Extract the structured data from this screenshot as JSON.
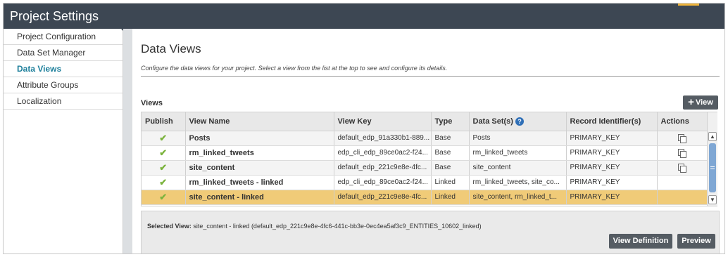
{
  "app": {
    "title": "Project Settings"
  },
  "sidebar": {
    "items": [
      {
        "label": "Project Configuration",
        "active": false
      },
      {
        "label": "Data Set Manager",
        "active": false
      },
      {
        "label": "Data Views",
        "active": true
      },
      {
        "label": "Attribute Groups",
        "active": false
      },
      {
        "label": "Localization",
        "active": false
      }
    ]
  },
  "main": {
    "title": "Data Views",
    "description": "Configure the data views for your project. Select a view from the list at the top to see and configure its details.",
    "views_label": "Views",
    "add_view_label": "View"
  },
  "table": {
    "columns": [
      "Publish",
      "View Name",
      "View Key",
      "Type",
      "Data Set(s)",
      "Record Identifier(s)",
      "Actions"
    ],
    "rows": [
      {
        "published": true,
        "name": "Posts",
        "key": "default_edp_91a330b1-889...",
        "type": "Base",
        "datasets": "Posts",
        "record_id": "PRIMARY_KEY",
        "has_action": true
      },
      {
        "published": true,
        "name": "rm_linked_tweets",
        "key": "edp_cli_edp_89ce0ac2-f24...",
        "type": "Base",
        "datasets": "rm_linked_tweets",
        "record_id": "PRIMARY_KEY",
        "has_action": true
      },
      {
        "published": true,
        "name": "site_content",
        "key": "default_edp_221c9e8e-4fc...",
        "type": "Base",
        "datasets": "site_content",
        "record_id": "PRIMARY_KEY",
        "has_action": true
      },
      {
        "published": true,
        "name": "rm_linked_tweets - linked",
        "key": "edp_cli_edp_89ce0ac2-f24...",
        "type": "Linked",
        "datasets": "rm_linked_tweets, site_co...",
        "record_id": "PRIMARY_KEY",
        "has_action": false
      },
      {
        "published": true,
        "name": "site_content - linked",
        "key": "default_edp_221c9e8e-4fc...",
        "type": "Linked",
        "datasets": "site_content, rm_linked_t...",
        "record_id": "PRIMARY_KEY",
        "has_action": false,
        "selected": true
      }
    ]
  },
  "selected_view": {
    "label": "Selected View:",
    "value": "site_content - linked (default_edp_221c9e8e-4fc6-441c-bb3e-0ec4ea5af3c9_ENTITIES_10602_linked)"
  },
  "buttons": {
    "view_definition": "View Definition",
    "preview": "Preview"
  },
  "icons": {
    "check": "checkmark-icon",
    "copy": "copy-icon",
    "help": "help-icon",
    "plus": "plus-icon"
  },
  "colors": {
    "header": "#3d4753",
    "accent": "#f0b53b",
    "selected_row": "#f0cb78",
    "link": "#1d7f9b",
    "check": "#7bb33d"
  }
}
